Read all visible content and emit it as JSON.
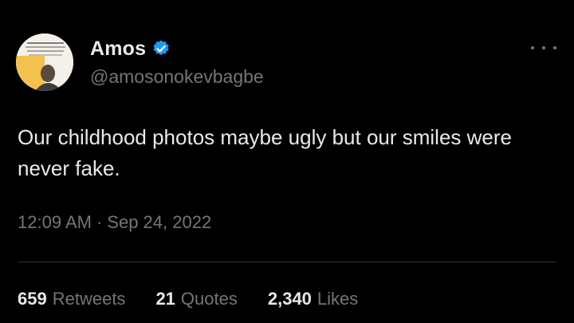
{
  "author": {
    "display_name": "Amos",
    "handle": "@amosonokevbagbe",
    "verified_icon": "verified-badge-icon",
    "verified_color": "#1d9bf0"
  },
  "tweet": {
    "text": "Our childhood photos maybe ugly but our smiles were never fake.",
    "time": "12:09 AM",
    "separator": "·",
    "date": "Sep 24, 2022"
  },
  "stats": {
    "retweets": {
      "count": "659",
      "label": "Retweets"
    },
    "quotes": {
      "count": "21",
      "label": "Quotes"
    },
    "likes": {
      "count": "2,340",
      "label": "Likes"
    }
  },
  "menu": {
    "more_icon": "more-options-icon"
  },
  "colors": {
    "background": "#000000",
    "primary_text": "#e7e9ea",
    "secondary_text": "#71767b",
    "divider": "#2f3336"
  }
}
